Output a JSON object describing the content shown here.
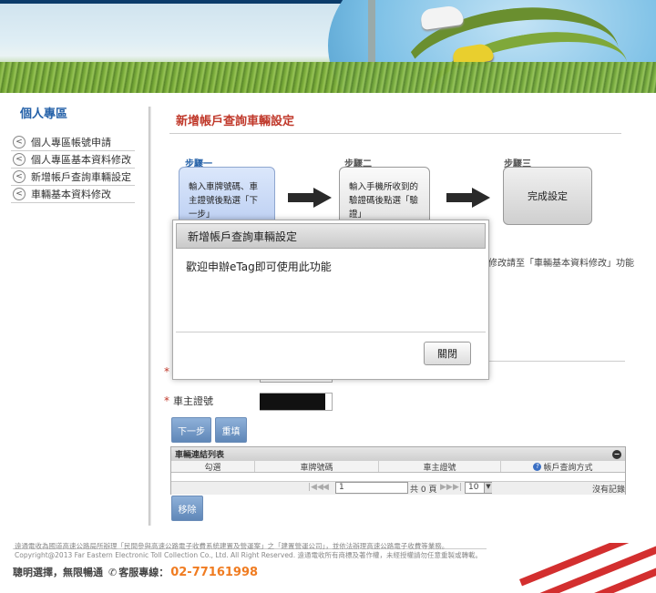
{
  "sidebar": {
    "title": "個人專區",
    "items": [
      {
        "label": "個人專區帳號申請"
      },
      {
        "label": "個人專區基本資料修改"
      },
      {
        "label": "新增帳戶查詢車輛設定"
      },
      {
        "label": "車輛基本資料修改"
      }
    ]
  },
  "main": {
    "title": "新增帳戶查詢車輛設定",
    "steps": [
      {
        "label": "步驟一",
        "text": "輸入車牌號碼、車主證號後點選「下一步」"
      },
      {
        "label": "步驟二",
        "text": "輸入手機所收到的驗證碼後點選「驗證」"
      },
      {
        "label": "步驟三",
        "text": "完成設定"
      }
    ],
    "hint_text": "修改請至「車輛基本資料修改」功能",
    "form": {
      "plate_required": "*",
      "owner_required": "*",
      "owner_label": "車主證號"
    },
    "buttons": {
      "next": "下一步",
      "reset": "重填",
      "delete": "移除"
    },
    "grid": {
      "title": "車輛連結列表",
      "columns": [
        "勾選",
        "車牌號碼",
        "車主證號",
        "帳戶查詢方式"
      ],
      "pager": {
        "first": "|◀◀",
        "prev": "◀",
        "page_value": "1",
        "of_pages": "共 0 頁",
        "next": "▶▶",
        "last": "▶|",
        "page_size": "10",
        "empty_text": "沒有記錄"
      }
    }
  },
  "modal": {
    "title": "新增帳戶查詢車輛設定",
    "message": "歡迎申辦eTag即可使用此功能",
    "close_label": "關閉"
  },
  "footer": {
    "line1": "遠通電收為國道高速公路局所辦理「民間參與高速公路電子收費系統建置及營運案」之「建置營運公司」，並依法辦理高速公路電子收費等業務。",
    "line2": "Copyright@2013 Far Eastern Electronic Toll Collection Co., Ltd. All Right Reserved. 遠通電收所有商標及著作權，未經授權請勿任意重製或轉載。",
    "slogan": "聰明選擇，無限暢通",
    "hotline_label": "客服專線：",
    "phone": "02-77161998"
  }
}
